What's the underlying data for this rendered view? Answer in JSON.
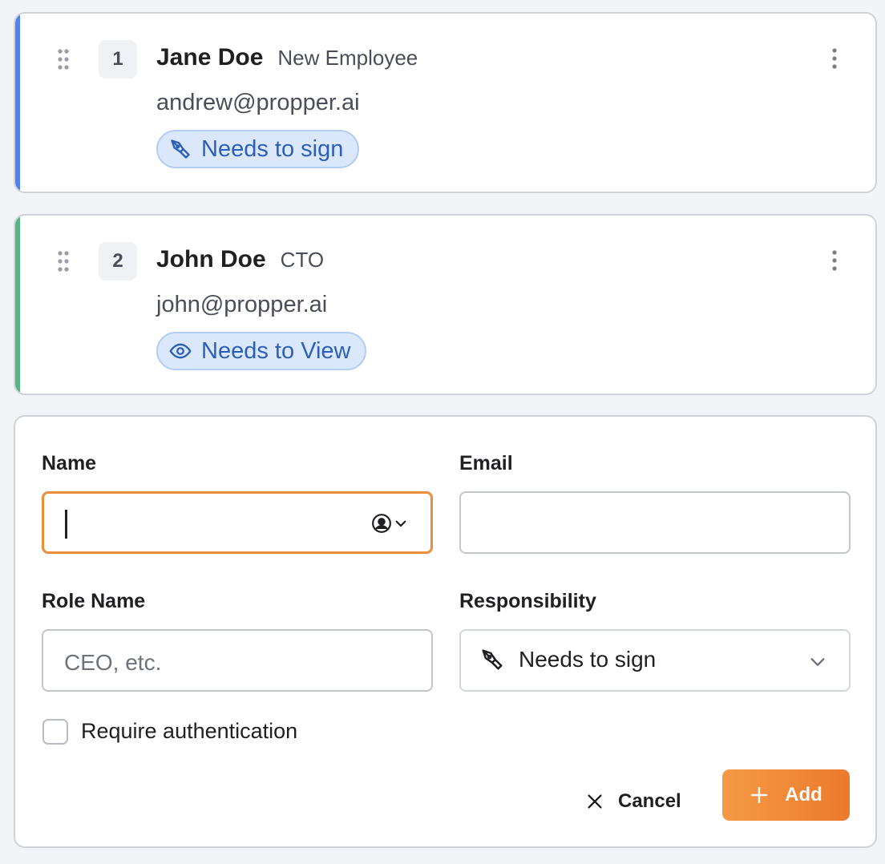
{
  "recipients": [
    {
      "order": "1",
      "name": "Jane Doe",
      "role": "New Employee",
      "email": "andrew@propper.ai",
      "responsibility": "Needs to sign",
      "responsibility_icon": "pen-nib-icon",
      "accent": "#4f82ee"
    },
    {
      "order": "2",
      "name": "John Doe",
      "role": "CTO",
      "email": "john@propper.ai",
      "responsibility": "Needs to View",
      "responsibility_icon": "eye-icon",
      "accent": "#57b483"
    }
  ],
  "form": {
    "name_label": "Name",
    "name_value": "",
    "email_label": "Email",
    "email_value": "",
    "role_label": "Role Name",
    "role_placeholder": "CEO, etc.",
    "responsibility_label": "Responsibility",
    "responsibility_value": "Needs to sign",
    "require_auth_label": "Require authentication",
    "require_auth_checked": false,
    "cancel_label": "Cancel",
    "add_label": "Add"
  },
  "colors": {
    "focus_border": "#ee8d3b",
    "badge_bg": "#dbe8fc",
    "badge_text": "#2c5fb8",
    "add_button": "#ef8533"
  }
}
